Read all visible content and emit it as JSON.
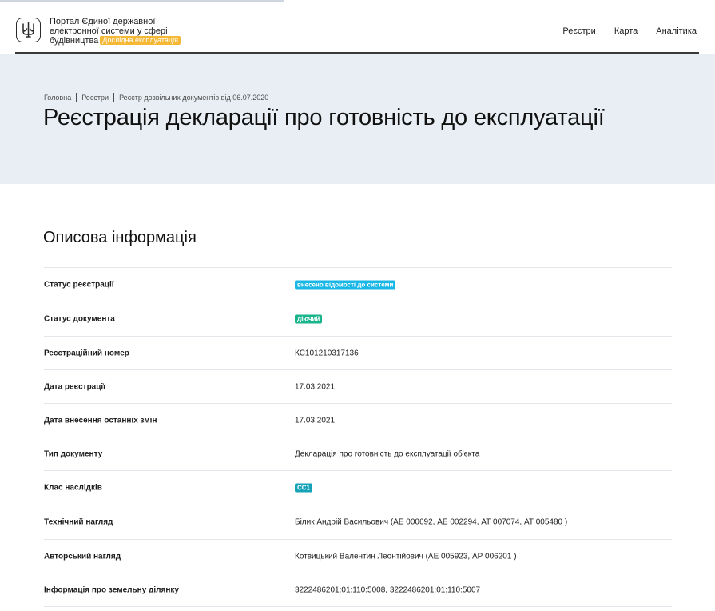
{
  "header": {
    "brand_line1": "Портал Єдиної державної",
    "brand_line2": "електронної системи у сфері",
    "brand_line3": "будівництва",
    "beta_badge": "Дослідна експлуатація",
    "nav": [
      "Реєстри",
      "Карта",
      "Аналітика"
    ]
  },
  "breadcrumbs": [
    "Головна",
    "Реєстри",
    "Реєстр дозвільних документів від 06.07.2020"
  ],
  "page_title": "Реєстрація декларації про готовність до експлуатації",
  "section_title": "Описова інформація",
  "rows": [
    {
      "label": "Статус реєстрації",
      "value": "внесено відомості до системи",
      "type": "tag",
      "color": "#19b7e6"
    },
    {
      "label": "Статус документа",
      "value": "діючий",
      "type": "tag",
      "color": "#19b38c"
    },
    {
      "label": "Реєстраційний номер",
      "value": "КС101210317136",
      "type": "text"
    },
    {
      "label": "Дата реєстрації",
      "value": "17.03.2021",
      "type": "text"
    },
    {
      "label": "Дата внесення останніх змін",
      "value": "17.03.2021",
      "type": "text"
    },
    {
      "label": "Тип документу",
      "value": "Декларація про готовність до експлуатації об'єкта",
      "type": "text"
    },
    {
      "label": "Клас наслідків",
      "value": "СС1",
      "type": "tag",
      "color": "#16a3b8"
    },
    {
      "label": "Технічний нагляд",
      "value": "Білик Андрій Васильович (АЕ 000692, АЕ 002294, АТ 007074, АТ 005480 )",
      "type": "text"
    },
    {
      "label": "Авторський нагляд",
      "value": "Котвицький Валентин Леонтійович (АЕ 005923, АР 006201 )",
      "type": "text"
    },
    {
      "label": "Інформація про земельну ділянку",
      "value": "3222486201:01:110:5008, 3222486201:01:110:5007",
      "type": "text"
    }
  ],
  "icons": {
    "logo": "trident-icon"
  }
}
